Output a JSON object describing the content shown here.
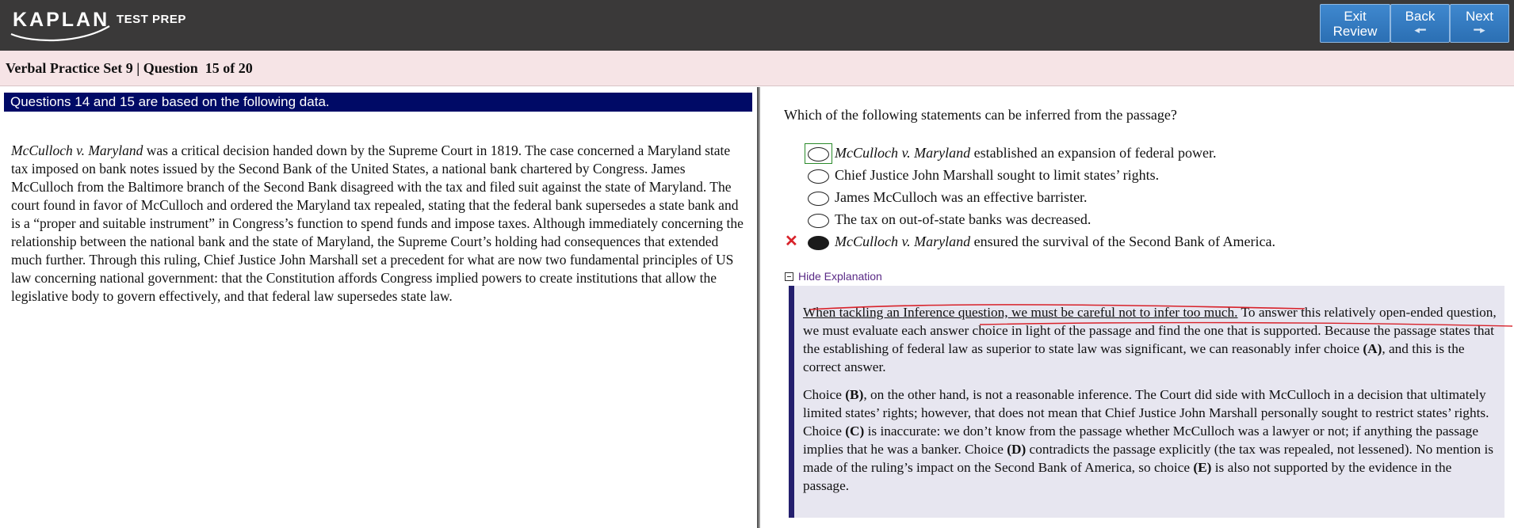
{
  "header": {
    "logo_main": "KAPLAN",
    "logo_sub": "TEST PREP",
    "buttons": {
      "exit_review": "Exit Review",
      "exit_line1": "Exit",
      "exit_line2": "Review",
      "back": "Back",
      "next": "Next"
    },
    "icons": {
      "back_arrow": "arrow-left-icon",
      "next_arrow": "arrow-right-icon"
    },
    "colors": {
      "bar": "#3a3939",
      "button": "#2f78c0"
    }
  },
  "question_bar": {
    "title": "Verbal Practice Set 9 | Question  15 of 20",
    "background": "#f6e4e6"
  },
  "passage": {
    "header": "Questions 14 and 15 are based on the following data.",
    "header_color": "#000a66",
    "case_name": "McCulloch v. Maryland",
    "text": " was a critical decision handed down by the Supreme Court in 1819. The case concerned a Maryland state tax imposed on bank notes issued by the Second Bank of the United States, a national bank chartered by Congress. James McCulloch from the Baltimore branch of the Second Bank disagreed with the tax and filed suit against the state of Maryland. The court found in favor of McCulloch and ordered the Maryland tax repealed, stating that the federal bank supersedes a state bank and is a “proper and suitable instrument” in Congress’s function to spend funds and impose taxes. Although immediately concerning the relationship between the national bank and the state of Maryland, the Supreme Court’s holding had consequences that extended much further. Through this ruling, Chief Justice John Marshall set a precedent for what are now two fundamental principles of US law concerning national government: that the Constitution affords Congress implied powers to create institutions that allow the legislative body to govern effectively, and that federal law supersedes state law."
  },
  "question": {
    "stem": "Which of the following statements can be inferred from the passage?",
    "choices": [
      {
        "italic": "McCulloch v. Maryland",
        "text": " established an expansion of federal power.",
        "state": "focused"
      },
      {
        "italic": "",
        "text": "Chief Justice John Marshall sought to limit states’ rights.",
        "state": "empty"
      },
      {
        "italic": "",
        "text": "James McCulloch was an effective barrister.",
        "state": "empty"
      },
      {
        "italic": "",
        "text": "The tax on out-of-state banks was decreased.",
        "state": "empty"
      },
      {
        "italic": "McCulloch v. Maryland",
        "text": " ensured the survival of the Second Bank of America.",
        "state": "selected-wrong"
      }
    ],
    "wrong_mark": "✕",
    "wrong_color": "#d8222a"
  },
  "explanation": {
    "toggle_label": "Hide Explanation",
    "p1_underlined": "When tackling an Inference question, we must be careful not to infer too much.",
    "p1_rest_a": " To answer this relatively open-ended question, we must evaluate each answer choice in light of the passage and find the one that is supported. Because the passage states that the establishing of federal law as superior to state law was significant, we can reasonably infer choice ",
    "p1_bold_a": "(A)",
    "p1_rest_b": ", and this is the correct answer.",
    "p2_a": "Choice ",
    "p2_b_bold": "(B)",
    "p2_c": ", on the other hand, is not a reasonable inference. The Court did side with McCulloch in a decision that ultimately limited states’ rights; however, that does not mean that Chief Justice John Marshall personally sought to restrict states’ rights. Choice ",
    "p2_d_bold": "(C)",
    "p2_e": " is inaccurate: we don’t know from the passage whether McCulloch was a lawyer or not; if anything the passage implies that he was a banker. Choice ",
    "p2_f_bold": "(D)",
    "p2_g": " contradicts the passage explicitly (the tax was repealed, not lessened). No mention is made of the ruling’s impact on the Second Bank of America, so choice ",
    "p2_h_bold": "(E)",
    "p2_i": " is also not supported by the evidence in the passage.",
    "bar_color": "#241f6e",
    "background": "#e7e6f0",
    "annotation_color": "#d8222a"
  }
}
